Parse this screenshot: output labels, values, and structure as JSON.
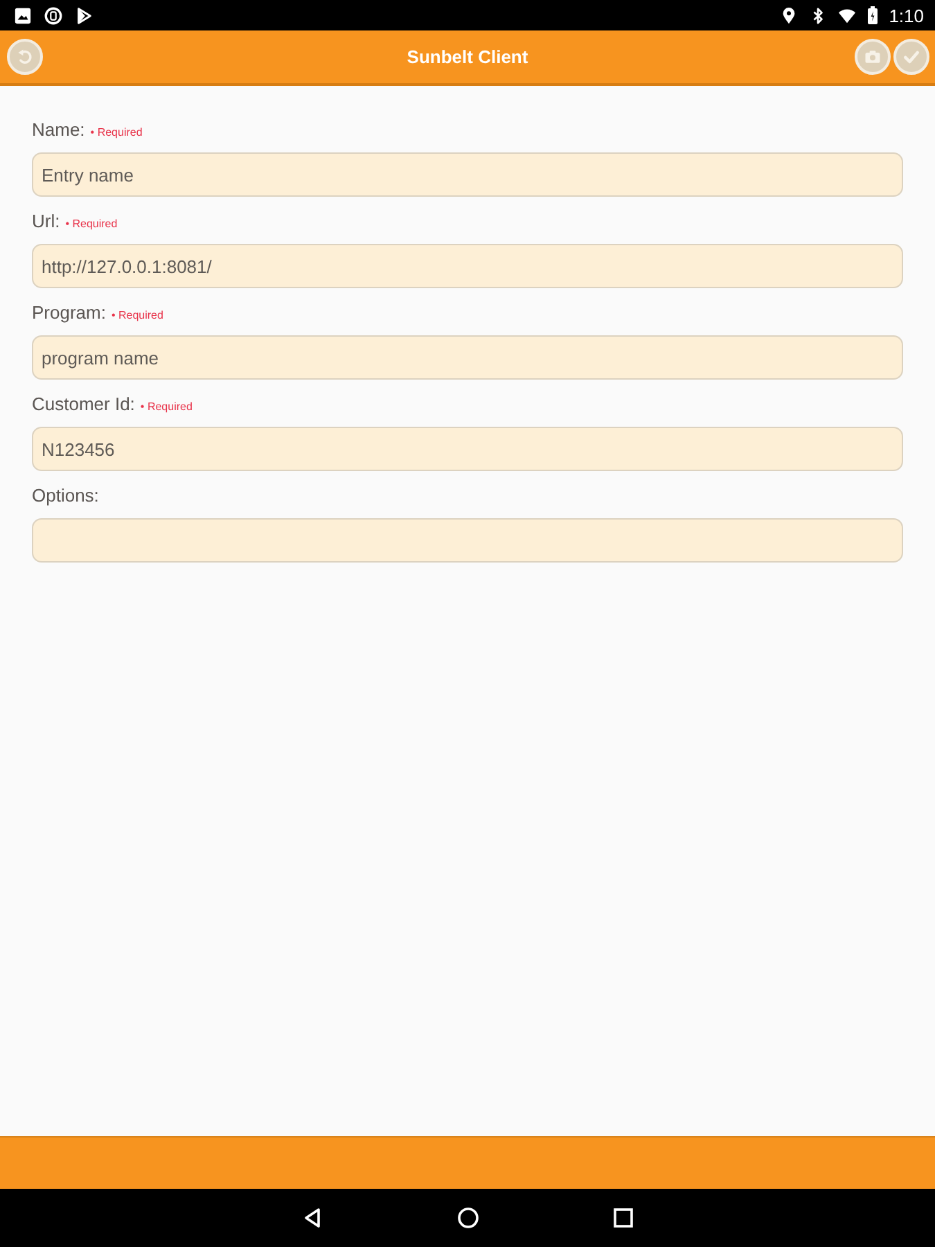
{
  "status_bar": {
    "time": "1:10"
  },
  "header": {
    "title": "Sunbelt Client"
  },
  "form": {
    "fields": [
      {
        "label": "Name:",
        "required_marker": "• Required",
        "placeholder": "Entry name"
      },
      {
        "label": "Url:",
        "required_marker": "• Required",
        "placeholder": "http://127.0.0.1:8081/"
      },
      {
        "label": "Program:",
        "required_marker": "• Required",
        "placeholder": "program name"
      },
      {
        "label": "Customer Id:",
        "required_marker": "• Required",
        "placeholder": "N123456"
      },
      {
        "label": "Options:"
      }
    ]
  }
}
